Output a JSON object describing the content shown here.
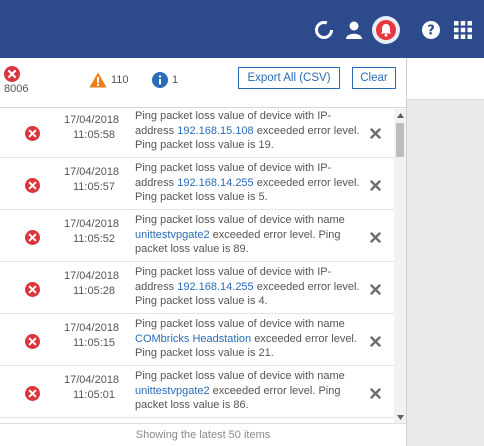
{
  "colors": {
    "topbar": "#2c4a8c",
    "error": "#d9363e",
    "warning": "#ef7d1a",
    "info": "#2a6cb8",
    "link": "#2a6cb8"
  },
  "topbar": {
    "icons": [
      "refresh-icon",
      "user-icon",
      "bell-icon",
      "help-icon",
      "apps-grid-icon"
    ]
  },
  "notifications": {
    "counts": {
      "error": "8006",
      "warning": "110",
      "info": "1"
    },
    "export_label": "Export All (CSV)",
    "clear_label": "Clear",
    "items": [
      {
        "date": "17/04/2018",
        "time": "11:05:58",
        "msg_pre": "Ping packet loss value of device with IP-address ",
        "msg_link": "192.168.15.108",
        "msg_post": " exceeded error level. Ping packet loss value is 19."
      },
      {
        "date": "17/04/2018",
        "time": "11:05:57",
        "msg_pre": "Ping packet loss value of device with IP-address ",
        "msg_link": "192.168.14.255",
        "msg_post": " exceeded error level. Ping packet loss value is 5."
      },
      {
        "date": "17/04/2018",
        "time": "11:05:52",
        "msg_pre": "Ping packet loss value of device with name ",
        "msg_link": "unittestvpgate2",
        "msg_post": " exceeded error level. Ping packet loss value is 89."
      },
      {
        "date": "17/04/2018",
        "time": "11:05:28",
        "msg_pre": "Ping packet loss value of device with IP-address ",
        "msg_link": "192.168.14.255",
        "msg_post": " exceeded error level. Ping packet loss value is 4."
      },
      {
        "date": "17/04/2018",
        "time": "11:05:15",
        "msg_pre": "Ping packet loss value of device with name ",
        "msg_link": "COMbricks Headstation",
        "msg_post": " exceeded error level. Ping packet loss value is 21."
      },
      {
        "date": "17/04/2018",
        "time": "11:05:01",
        "msg_pre": "Ping packet loss value of device with name ",
        "msg_link": "unittestvpgate2",
        "msg_post": " exceeded error level. Ping packet loss value is 86."
      }
    ],
    "footer": "Showing the latest 50 items"
  }
}
